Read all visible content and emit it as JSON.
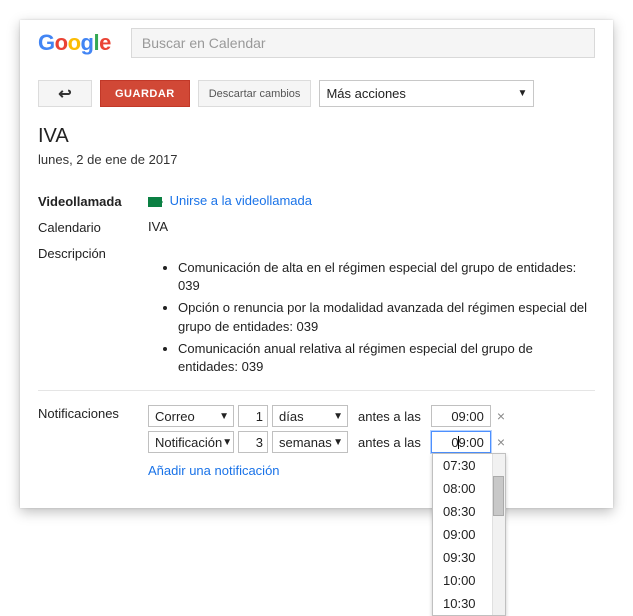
{
  "logo_letters": [
    "G",
    "o",
    "o",
    "g",
    "l",
    "e"
  ],
  "search_placeholder": "Buscar en Calendar",
  "toolbar": {
    "back_glyph": "↩",
    "save": "GUARDAR",
    "discard": "Descartar cambios",
    "more": "Más acciones"
  },
  "event": {
    "title": "IVA",
    "date": "lunes, 2 de ene de 2017"
  },
  "fields": {
    "video_label": "Videollamada",
    "video_link": "Unirse a la videollamada",
    "calendar_label": "Calendario",
    "calendar_value": "IVA",
    "description_label": "Descripción",
    "description_items": [
      "Comunicación de alta en el régimen especial del grupo de entidades: 039",
      "Opción o renuncia por la modalidad avanzada del régimen especial del grupo de entidades: 039",
      "Comunicación anual relativa al régimen especial del grupo de entidades: 039"
    ],
    "notifications_label": "Notificaciones"
  },
  "notifications": [
    {
      "method": "Correo",
      "qty": "1",
      "unit": "días",
      "at_label": "antes a las",
      "time": "09:00"
    },
    {
      "method": "Notificación",
      "qty": "3",
      "unit": "semanas",
      "at_label": "antes a las",
      "time": "09:00"
    }
  ],
  "add_notification": "Añadir una notificación",
  "time_options": [
    "07:30",
    "08:00",
    "08:30",
    "09:00",
    "09:30",
    "10:00",
    "10:30"
  ]
}
